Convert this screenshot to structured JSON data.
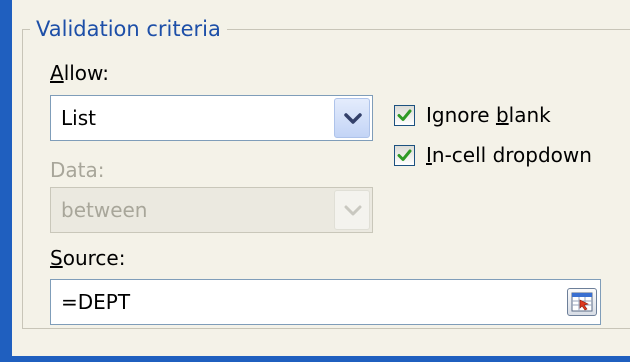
{
  "group": {
    "title": "Validation criteria"
  },
  "allow": {
    "label_key": "A",
    "label_rest": "llow:",
    "value": "List"
  },
  "data": {
    "label": "Data:",
    "value": "between"
  },
  "ignore_blank": {
    "label_pre": "Ignore ",
    "label_key": "b",
    "label_post": "lank",
    "checked": true
  },
  "incell_dropdown": {
    "label_key": "I",
    "label_rest": "n-cell dropdown",
    "checked": true
  },
  "source": {
    "label_key": "S",
    "label_rest": "ource:",
    "value": "=DEPT"
  },
  "icons": {
    "dropdown": "chevron-down-icon",
    "check": "checkmark-icon",
    "collapse": "collapse-dialog-icon"
  },
  "colors": {
    "title": "#1d4fa8",
    "border_accent": "#1f5fbf",
    "check": "#2e9a26"
  }
}
